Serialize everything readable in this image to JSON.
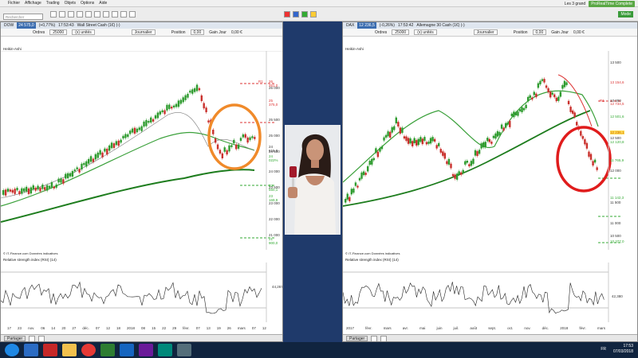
{
  "menu": [
    "Fichier",
    "Affichage",
    "Trading",
    "Objets",
    "Options",
    "Aide"
  ],
  "top_right": {
    "label": "Les 3 grand",
    "brand": "ProRealTime Complete",
    "status": "Mode"
  },
  "search": {
    "placeholder": "Rechercher"
  },
  "left_panel": {
    "flag": "24 575,0",
    "change": "(+0,77%)",
    "time": "17:53:43",
    "title": "Wall Street Cash (1€) (-)",
    "orders_label": "Ordres",
    "orders_value": "25000",
    "units": "(x) unités",
    "period": "Journalier",
    "position_label": "Position",
    "position_value": "0,00",
    "gain_label": "Gain Jour",
    "gain_value": "0,00 €",
    "chart_label": "Heikin-Ashi",
    "credit": "© IT-Finance.com Données indicatives",
    "rsi_label": "Relative strength index (RSI) (14)",
    "rsi_value": "44,267",
    "axis": [
      "17",
      "23",
      "nov.",
      "06",
      "14",
      "20",
      "27",
      "déc.",
      "07",
      "12",
      "18",
      "2018",
      "08",
      "15",
      "22",
      "29",
      "févr.",
      "07",
      "13",
      "19",
      "26",
      "mars",
      "07",
      "12"
    ],
    "price_ticks": [
      "26 000",
      "25 500",
      "25 000",
      "24 500",
      "24 000",
      "23 500",
      "23 000",
      "22 500",
      "22 000",
      "21 500",
      "21 000"
    ],
    "levels": [
      "R1",
      "26 461,0",
      "25 375,0",
      "24 615,0",
      "24 022%",
      "23 550,1",
      "23 169,9",
      "21 900,0"
    ],
    "btn_partager": "Partager"
  },
  "right_panel": {
    "flag": "12 236,5",
    "change": "(-0,26%)",
    "time": "17:53:42",
    "title": "Allemagne 30 Cash (1€) (-)",
    "orders_label": "Ordres",
    "orders_value": "25000",
    "units": "(x) unités",
    "period": "Journalier",
    "position_label": "Position",
    "position_value": "0,00",
    "gain_label": "Gain Jour",
    "gain_value": "0,00 €",
    "chart_label": "Heikin-Ashi",
    "credit": "© IT-Finance.com Données indicatives",
    "rsi_label": "Relative strength index (RSI) (14)",
    "rsi_value": "42,380",
    "axis": [
      "2017",
      "févr.",
      "mars",
      "avr.",
      "mai",
      "juin",
      "juil.",
      "août",
      "sept.",
      "oct.",
      "nov.",
      "déc.",
      "2018",
      "févr.",
      "mars"
    ],
    "price_ticks": [
      "13 500",
      "13 000",
      "12 500",
      "12 000",
      "11 500",
      "11 000",
      "10 500"
    ],
    "levels": [
      "R1",
      "13 154,6",
      "12 734,5",
      "12 501,6",
      "12 236,1",
      "12 120,8",
      "12 000",
      "11 765,9",
      "11 142,3",
      "10 377,0"
    ],
    "btn_partager": "Partager"
  },
  "taskbar": {
    "time": "17:53",
    "date": "07/03/2018",
    "lang": "FR"
  },
  "colors": {
    "orange_circle": "#f08a2a",
    "red_circle": "#e01c1c",
    "up": "#2e9b2e",
    "down": "#c9302c"
  }
}
